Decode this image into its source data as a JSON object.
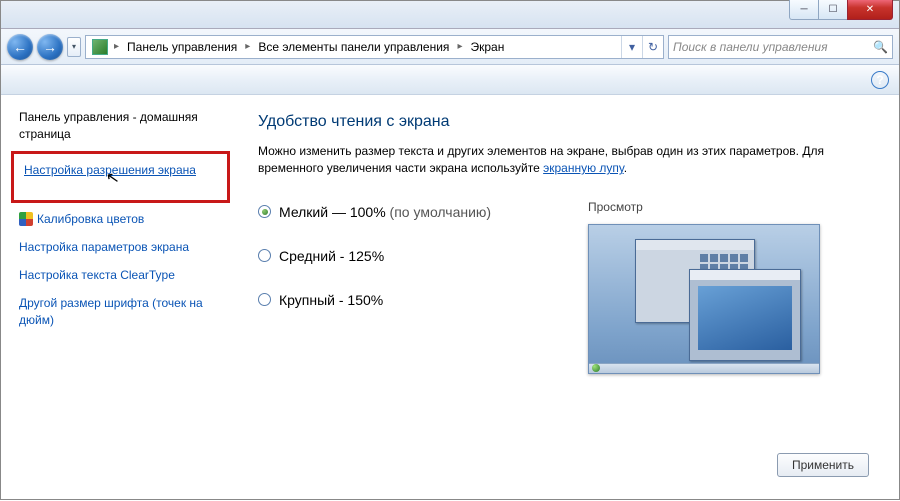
{
  "window": {
    "min_glyph": "─",
    "max_glyph": "☐",
    "close_glyph": "✕"
  },
  "nav": {
    "back_glyph": "←",
    "fwd_glyph": "→",
    "dd_glyph": "▾",
    "refresh_glyph": "↻"
  },
  "breadcrumbs": {
    "root_arrow": "▸",
    "a": "Панель управления",
    "b": "Все элементы панели управления",
    "c": "Экран"
  },
  "search": {
    "placeholder": "Поиск в панели управления",
    "mag_glyph": "🔍"
  },
  "help_glyph": "?",
  "sidebar": {
    "home": "Панель управления - домашняя страница",
    "link_resolution": "Настройка разрешения экрана",
    "link_calibration": "Калибровка цветов",
    "link_params": "Настройка параметров экрана",
    "link_cleartype": "Настройка текста ClearType",
    "link_dpi": "Другой размер шрифта (точек на дюйм)",
    "cursor_glyph": "↖"
  },
  "main": {
    "title": "Удобство чтения с экрана",
    "desc_a": "Можно изменить размер текста и других элементов на экране, выбрав один из этих параметров. Для временного увеличения части экрана используйте ",
    "desc_link": "экранную лупу",
    "desc_b": ".",
    "opt_small_a": "Мелкий — 100%",
    "opt_small_b": " (по умолчанию)",
    "opt_medium": "Средний - 125%",
    "opt_large": "Крупный - 150%",
    "preview_label": "Просмотр",
    "apply": "Применить"
  }
}
